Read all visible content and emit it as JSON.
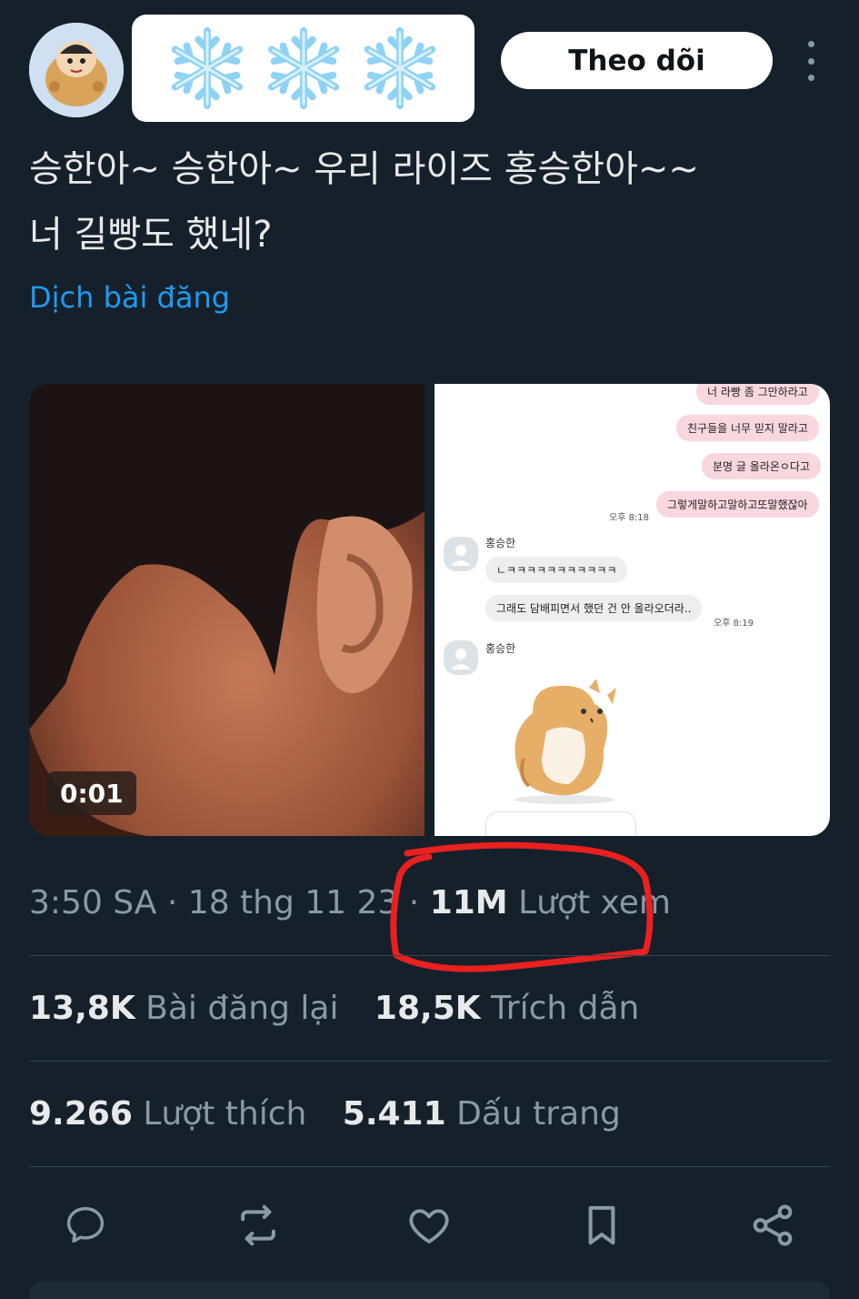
{
  "header": {
    "display_name_decoration": "❄️❄️❄️",
    "follow_label": "Theo dõi"
  },
  "tweet": {
    "text_line1": "승한아~ 승한아~ 우리 라이즈 홍승한아~~",
    "text_line2": "너 길빵도 했네?",
    "translate_label": "Dịch bài đăng"
  },
  "media": {
    "video_duration": "0:01",
    "chat": {
      "msg_top_partial": "너 라빵 좀 그만하라고",
      "msg1": "친구들을 너무 믿지 말라고",
      "msg2": "분명 글 올라온ㅇ다고",
      "msg3": "그렇게말하고말하고또말했잖아",
      "time1": "오후 8:18",
      "sender1": "홍승한",
      "reply1": "ㄴㅋㅋㅋㅋㅋㅋㅋㅋㅋㅋㅋ",
      "reply2": "그래도 담배피면서 했던 건 안 올라오더라..",
      "time2": "오후 8:19",
      "sender2": "홍승한"
    }
  },
  "meta": {
    "time": "3:50 SA",
    "separator": "·",
    "date": "18 thg 11 23",
    "views_count": "11M",
    "views_label": "Lượt xem"
  },
  "stats": {
    "reposts_count": "13,8K",
    "reposts_label": "Bài đăng lại",
    "quotes_count": "18,5K",
    "quotes_label": "Trích dẫn",
    "likes_count": "9.266",
    "likes_label": "Lượt thích",
    "bookmarks_count": "5.411",
    "bookmarks_label": "Dấu trang"
  },
  "actions": [
    "reply-icon",
    "repost-icon",
    "like-icon",
    "bookmark-icon",
    "share-icon"
  ],
  "colors": {
    "background": "#15202b",
    "accent": "#1d9bf0",
    "annotation": "#e8201f",
    "muted_text": "#8b98a5"
  }
}
